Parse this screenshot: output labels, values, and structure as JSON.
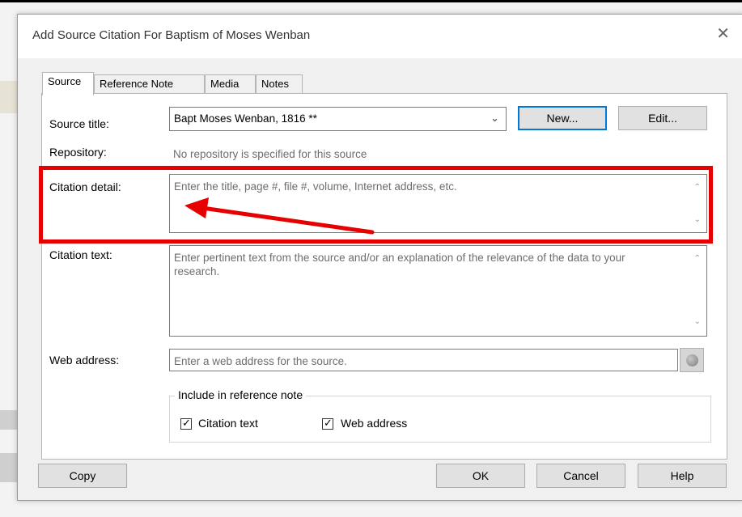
{
  "dialog": {
    "title": "Add Source Citation For Baptism of Moses Wenban",
    "close_symbol": "✕"
  },
  "tabs": [
    {
      "label": "Source",
      "active": true
    },
    {
      "label": "Reference Note",
      "active": false
    },
    {
      "label": "Media",
      "active": false
    },
    {
      "label": "Notes",
      "active": false
    }
  ],
  "form": {
    "source_title_label": "Source title:",
    "source_title_value": "Bapt Moses Wenban, 1816 **",
    "new_button": "New...",
    "edit_button": "Edit...",
    "repository_label": "Repository:",
    "repository_message": "No repository is specified for this source",
    "citation_detail_label": "Citation detail:",
    "citation_detail_placeholder": "Enter the title, page #, file #, volume, Internet address, etc.",
    "citation_text_label": "Citation text:",
    "citation_text_placeholder": "Enter pertinent text from the source and/or an explanation of the relevance of the data to your research.",
    "web_address_label": "Web address:",
    "web_address_placeholder": "Enter a web address for the source.",
    "include_group_label": "Include in reference note",
    "include_citation_text": {
      "label": "Citation text",
      "checked": true
    },
    "include_web_address": {
      "label": "Web address",
      "checked": true
    }
  },
  "footer": {
    "copy_button": "Copy",
    "ok_button": "OK",
    "cancel_button": "Cancel",
    "help_button": "Help"
  },
  "icons": {
    "dropdown": "chevron-down-icon",
    "web_lookup": "globe-icon",
    "check": "✓"
  },
  "colors": {
    "highlight": "#e60000",
    "default_button_border": "#0078d7"
  }
}
